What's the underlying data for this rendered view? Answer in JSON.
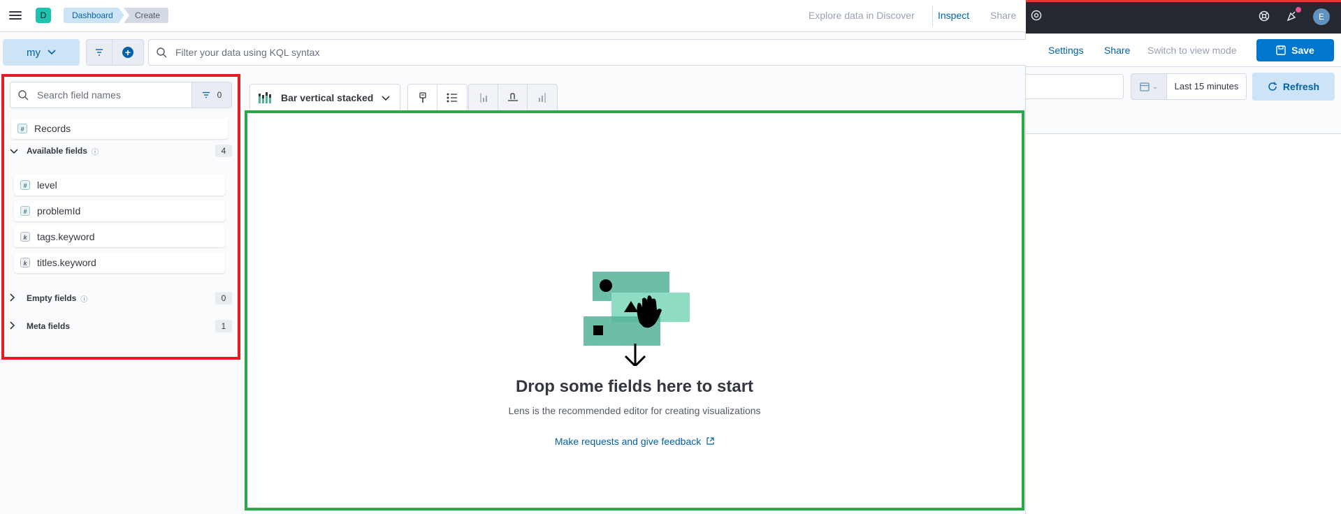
{
  "background": {
    "header_icons": [
      "help-icon",
      "newsfeed-icon",
      "user-avatar"
    ],
    "avatar_letter": "E",
    "actions": {
      "settings": "Settings",
      "share": "Share",
      "switch_mode": "Switch to view mode",
      "save": "Save"
    },
    "date_range": "Last 15 minutes",
    "refresh": "Refresh"
  },
  "lens": {
    "header": {
      "app_initial": "D",
      "breadcrumbs": [
        "Dashboard",
        "Create"
      ],
      "links": {
        "discover": "Explore data in Discover",
        "inspect": "Inspect",
        "share": "Share"
      }
    },
    "query": {
      "data_view": "my",
      "kql_placeholder": "Filter your data using KQL syntax"
    },
    "fields": {
      "search_placeholder": "Search field names",
      "filter_count": "0",
      "records": "Records",
      "available": {
        "label": "Available fields",
        "count": "4",
        "items": [
          {
            "name": "level",
            "type": "#"
          },
          {
            "name": "problemId",
            "type": "#"
          },
          {
            "name": "tags.keyword",
            "type": "k"
          },
          {
            "name": "titles.keyword",
            "type": "k"
          }
        ]
      },
      "empty": {
        "label": "Empty fields",
        "count": "0"
      },
      "meta": {
        "label": "Meta fields",
        "count": "1"
      }
    },
    "toolbar": {
      "chart_type": "Bar vertical stacked"
    },
    "workspace": {
      "title": "Drop some fields here to start",
      "subtitle": "Lens is the recommended editor for creating visualizations",
      "feedback_link": "Make requests and give feedback"
    },
    "colors": {
      "accent": "#0077cc",
      "fields_highlight": "#e51c23",
      "workspace_highlight": "#2ba84a"
    }
  }
}
